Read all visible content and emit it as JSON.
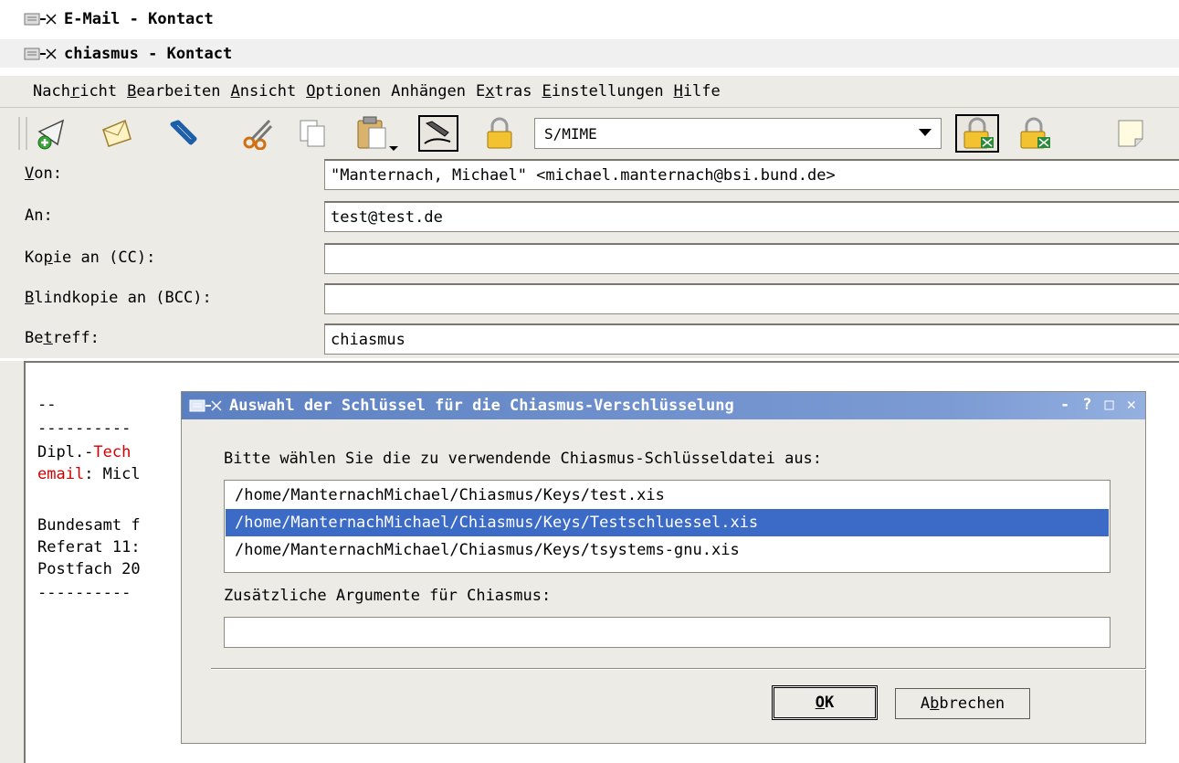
{
  "window_titles": [
    "E-Mail - Kontact",
    "chiasmus - Kontact"
  ],
  "menu": [
    {
      "pre": "Nach",
      "key": "r",
      "post": "icht"
    },
    {
      "pre": "",
      "key": "B",
      "post": "earbeiten"
    },
    {
      "pre": "",
      "key": "A",
      "post": "nsicht"
    },
    {
      "pre": "",
      "key": "O",
      "post": "ptionen"
    },
    {
      "pre": "Anhän",
      "key": "g",
      "post": "en"
    },
    {
      "pre": "E",
      "key": "x",
      "post": "tras"
    },
    {
      "pre": "",
      "key": "E",
      "post": "instellungen"
    },
    {
      "pre": "",
      "key": "H",
      "post": "ilfe"
    }
  ],
  "toolbar": {
    "crypto_format": "S/MIME",
    "icons": [
      "send-new-icon",
      "send-later-icon",
      "attach-icon",
      "cut-icon",
      "copy-icon",
      "paste-icon",
      "sign-icon",
      "encrypt-icon",
      "chiasmus-sign-icon",
      "chiasmus-encrypt-icon",
      "note-icon"
    ]
  },
  "header": {
    "from_label": {
      "key": "V",
      "post": "on:"
    },
    "from_value": "\"Manternach, Michael\" <michael.manternach@bsi.bund.de>",
    "to_label": "An:",
    "to_value": "test@test.de",
    "cc_label": {
      "pre": "Ko",
      "key": "p",
      "post": "ie an (CC):"
    },
    "cc_value": "",
    "bcc_label": {
      "key": "B",
      "post": "lindkopie an (BCC):"
    },
    "bcc_value": "",
    "subject_label": {
      "pre": "Be",
      "key": "t",
      "post": "reff:"
    },
    "subject_value": "chiasmus"
  },
  "editor": {
    "line1": "--",
    "line2": "----------",
    "line3_a": "Dipl.-",
    "line3_b": "Tech",
    "line4_a": "email",
    "line4_b": ": Micl",
    "line5": "Bundesamt f",
    "line6": "Referat 11:",
    "line7": "Postfach 20",
    "line8": "----------"
  },
  "dialog": {
    "title": "Auswahl der Schlüssel für die Chiasmus-Verschlüsselung",
    "controls": [
      "-",
      "?",
      "□",
      "✕"
    ],
    "prompt": "Bitte wählen Sie die zu verwendende Chiasmus-Schlüsseldatei aus:",
    "keys": [
      "/home/ManternachMichael/Chiasmus/Keys/test.xis",
      "/home/ManternachMichael/Chiasmus/Keys/Testschluessel.xis",
      "/home/ManternachMichael/Chiasmus/Keys/tsystems-gnu.xis"
    ],
    "selected_index": 1,
    "args_label": "Zusätzliche Argumente für Chiasmus:",
    "args_value": "",
    "ok": {
      "key": "O",
      "post": "K"
    },
    "cancel": {
      "pre": "A",
      "key": "b",
      "post": "brechen"
    }
  }
}
